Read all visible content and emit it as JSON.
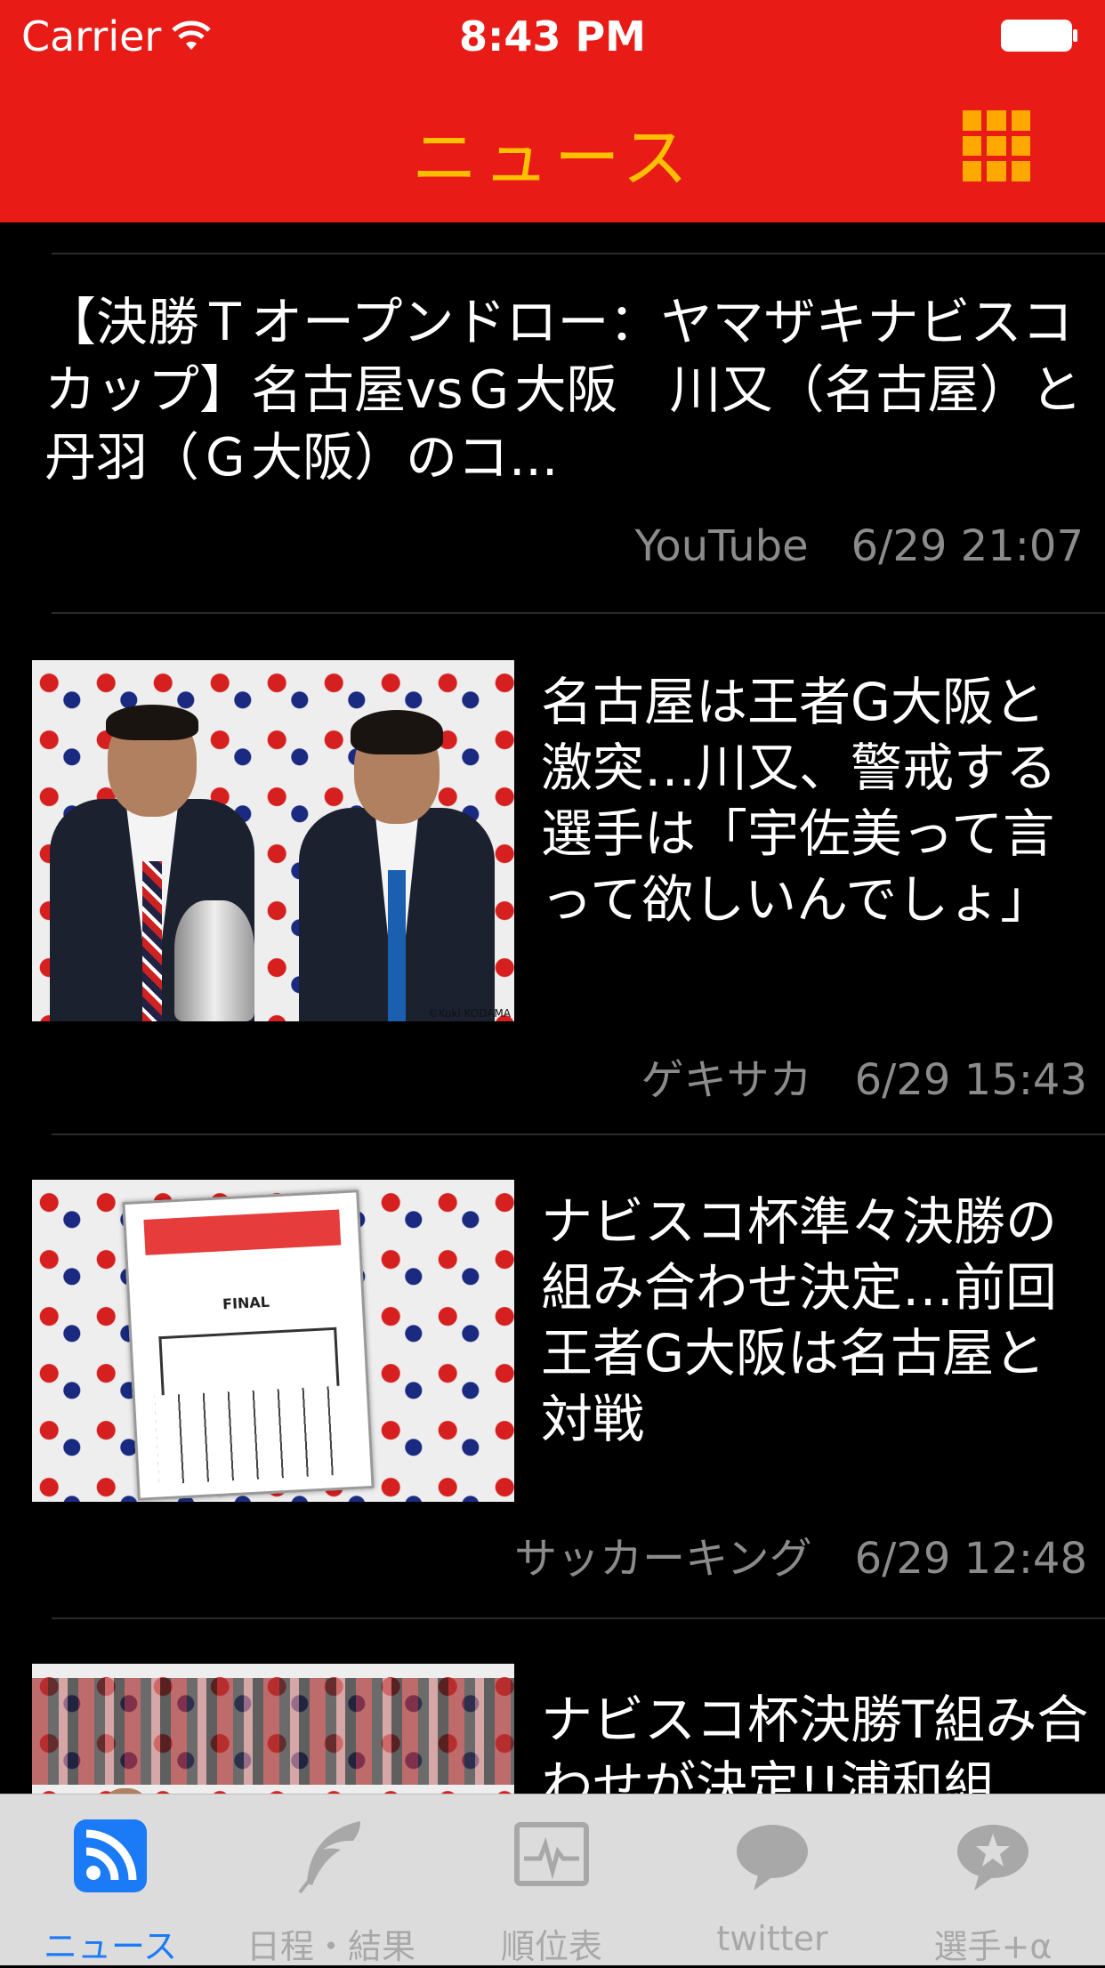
{
  "status_bar": {
    "carrier": "Carrier",
    "time": "8:43 PM"
  },
  "nav": {
    "title": "ニュース",
    "menu_icon": "grid-icon",
    "accent": "#ffc000",
    "bar_color": "#e81b17"
  },
  "articles": [
    {
      "title": "【決勝Ｔオープンドロー：ヤマザキナビスコカップ】名古屋vsＧ大阪　川又（名古屋）と丹羽（Ｇ大阪）のコ...",
      "source": "YouTube",
      "time": "6/29 21:07"
    },
    {
      "title": "名古屋は王者G大阪と激突…川又、警戒する選手は「宇佐美って言って欲しいんでしょ」",
      "source": "ゲキサカ",
      "time": "6/29 15:43"
    },
    {
      "title": "ナビスコ杯準々決勝の組み合わせ決定…前回王者G大阪は名古屋と対戦",
      "source": "サッカーキング",
      "time": "6/29 12:48"
    },
    {
      "title": "ナビスコ杯決勝T組み合わせが決定!!浦和組",
      "source": "",
      "time": ""
    }
  ],
  "tabs": [
    {
      "label": "ニュース",
      "icon": "rss-icon",
      "active": true
    },
    {
      "label": "日程・結果",
      "icon": "feather-icon",
      "active": false
    },
    {
      "label": "順位表",
      "icon": "chart-icon",
      "active": false
    },
    {
      "label": "twitter",
      "icon": "speech-bubble-icon",
      "active": false
    },
    {
      "label": "選手+α",
      "icon": "star-bubble-icon",
      "active": false
    }
  ]
}
